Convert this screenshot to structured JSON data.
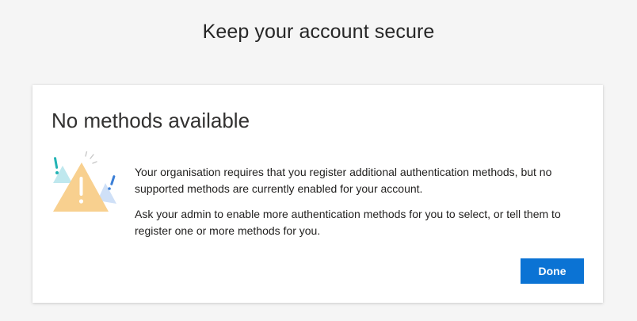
{
  "header": {
    "title": "Keep your account secure"
  },
  "card": {
    "title": "No methods available",
    "icon": "warning-illustration-icon",
    "paragraphs": [
      "Your organisation requires that you register additional authentication methods, but no supported methods are currently enabled for your account.",
      "Ask your admin to enable more authentication methods for you to select, or tell them to register one or more methods for you."
    ],
    "done_label": "Done"
  },
  "colors": {
    "accent": "#0b73d4",
    "warning": "#f7d08a",
    "warning_mark": "#ffffff",
    "teal": "#2bb5b5",
    "blue": "#3b7fd6",
    "background": "#f5f5f5"
  }
}
